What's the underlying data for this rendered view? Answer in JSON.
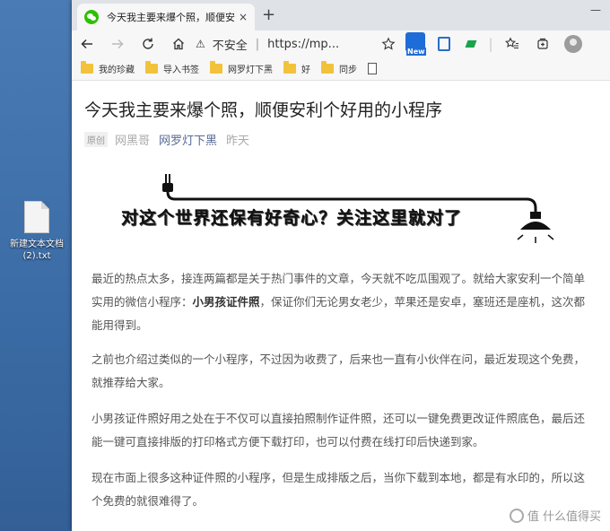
{
  "desktop": {
    "file_label": "新建文本文档\n(2).txt"
  },
  "browser": {
    "tab_title": "今天我主要来爆个照，顺便安利",
    "tab_close": "×",
    "new_tab": "+",
    "window_controls": "—",
    "address": {
      "security_label": "不安全",
      "separator": "|",
      "url": "https://mp..."
    },
    "ext_new_label": "New",
    "bookmarks": [
      "我的珍藏",
      "导入书签",
      "网罗灯下黑",
      "好",
      "同步"
    ]
  },
  "article": {
    "title": "今天我主要来爆个照，顺便安利个好用的小程序",
    "original_badge": "原创",
    "author": "网黑哥",
    "account": "网罗灯下黑",
    "time": "昨天",
    "banner_text": "对这个世界还保有好奇心？关注这里就对了",
    "p1_before": "最近的热点太多，接连两篇都是关于热门事件的文章，今天就不吃瓜围观了。就给大家安利一个简单实用的微信小程序：",
    "p1_bold": "小男孩证件照",
    "p1_after": "，保证你们无论男女老少，苹果还是安卓，塞班还是座机，这次都能用得到。",
    "p2": "之前也介绍过类似的一个小程序，不过因为收费了，后来也一直有小伙伴在问，最近发现这个免费，就推荐给大家。",
    "p3": "小男孩证件照好用之处在于不仅可以直接拍照制作证件照，还可以一键免费更改证件照底色，最后还能一键可直接排版的打印格式方便下载打印，也可以付费在线打印后快递到家。",
    "p4": "现在市面上很多这种证件照的小程序，但是生成排版之后，当你下载到本地，都是有水印的，所以这个免费的就很难得了。",
    "watermark": "值 什么值得买"
  }
}
